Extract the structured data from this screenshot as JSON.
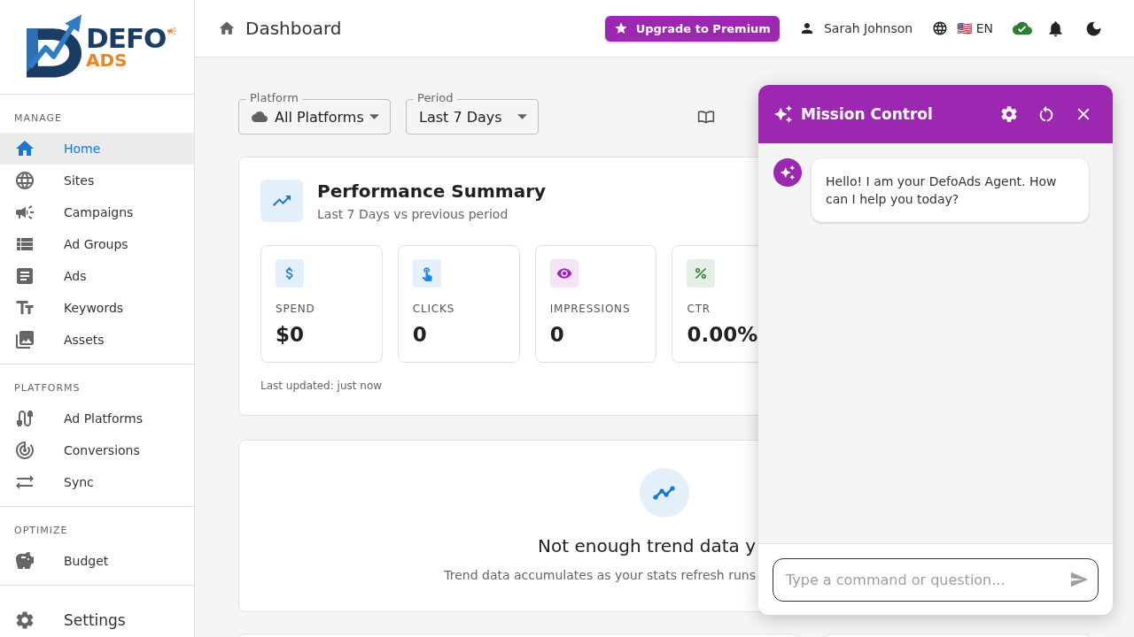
{
  "sidebar": {
    "logo": {
      "line_1": "DEFO",
      "line_2": "ADS"
    },
    "sections": [
      {
        "title": "MANAGE",
        "items": [
          {
            "label": "Home",
            "selected": true
          },
          {
            "label": "Sites",
            "selected": false
          },
          {
            "label": "Campaigns",
            "selected": false
          },
          {
            "label": "Ad Groups",
            "selected": false
          },
          {
            "label": "Ads",
            "selected": false
          },
          {
            "label": "Keywords",
            "selected": false
          },
          {
            "label": "Assets",
            "selected": false
          }
        ]
      },
      {
        "title": "PLATFORMS",
        "items": [
          {
            "label": "Ad Platforms",
            "selected": false
          },
          {
            "label": "Conversions",
            "selected": false
          },
          {
            "label": "Sync",
            "selected": false
          }
        ]
      },
      {
        "title": "OPTIMIZE",
        "items": [
          {
            "label": "Budget",
            "selected": false
          }
        ]
      }
    ],
    "footer_item": {
      "label": "Settings",
      "selected": false
    }
  },
  "header": {
    "title": "Dashboard",
    "upgrade_button": "Upgrade to Premium",
    "user_name": "Sarah Johnson",
    "language": "🇺🇸 EN"
  },
  "filters": [
    {
      "label": "Platform",
      "value": "All Platforms"
    },
    {
      "label": "Period",
      "value": "Last 7 Days"
    }
  ],
  "performance_summary": {
    "title": "Performance Summary",
    "subtitle": "Last 7 Days vs previous period",
    "stats": [
      {
        "label": "SPEND",
        "value": "$0",
        "color": "#1976d2"
      },
      {
        "label": "CLICKS",
        "value": "0",
        "color": "#1e88e5"
      },
      {
        "label": "IMPRESSIONS",
        "value": "0",
        "color": "#9c27b0"
      },
      {
        "label": "CTR",
        "value": "0.00%",
        "color": "#2e7d32"
      }
    ],
    "last_updated": "Last updated: just now"
  },
  "trend_card": {
    "title": "Not enough trend data y",
    "subtitle": "Trend data accumulates as your stats refresh runs"
  },
  "chat_panel": {
    "title": "Mission Control",
    "messages": [
      {
        "kind": "agent",
        "text": "Hello! I am your DefoAds Agent. How can I help you today?"
      }
    ],
    "input": {
      "placeholder": "Type a command or question..."
    }
  }
}
